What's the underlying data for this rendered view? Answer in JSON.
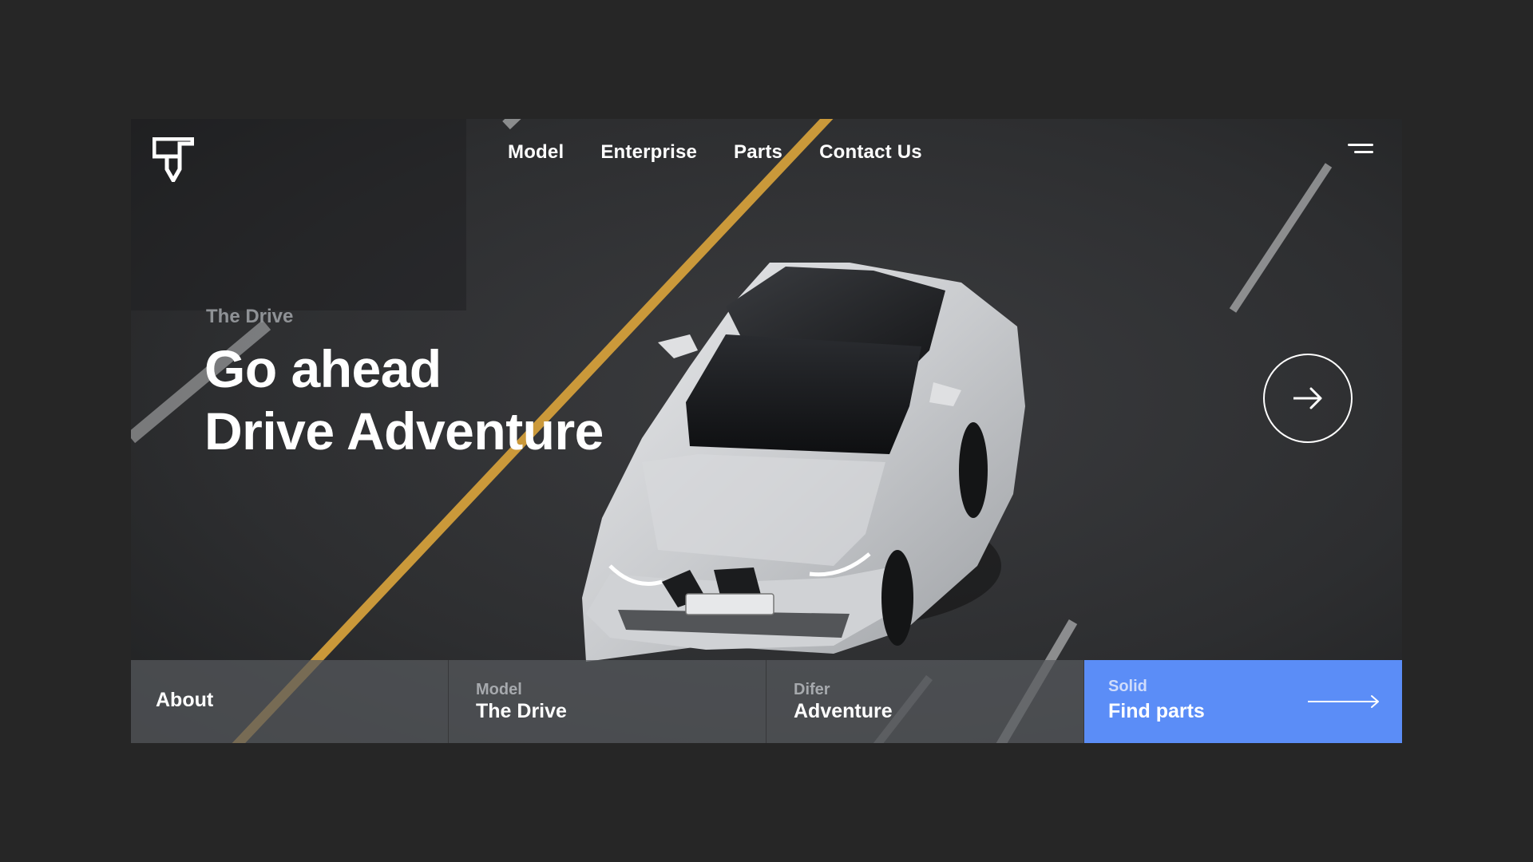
{
  "brand": {
    "logo_icon": "st-shield-logo-icon"
  },
  "nav": {
    "items": [
      {
        "label": "Model"
      },
      {
        "label": "Enterprise"
      },
      {
        "label": "Parts"
      },
      {
        "label": "Contact Us"
      }
    ],
    "menu_icon": "hamburger-menu-icon"
  },
  "hero": {
    "eyebrow": "The Drive",
    "headline_line1": "Go ahead",
    "headline_line2": "Drive Adventure",
    "next_icon": "arrow-right-icon",
    "image_subject": "white sports sedan on asphalt road"
  },
  "bottom_tiles": [
    {
      "small": "",
      "big": "About"
    },
    {
      "small": "Model",
      "big": "The Drive"
    },
    {
      "small": "Difer",
      "big": "Adventure"
    },
    {
      "small": "Solid",
      "big": "Find parts",
      "icon": "long-arrow-right-icon"
    }
  ],
  "colors": {
    "page_background": "#262626",
    "accent_blue": "#5b8df7",
    "road_line_yellow": "#d8a23b",
    "tile_gray": "#585a5e"
  }
}
